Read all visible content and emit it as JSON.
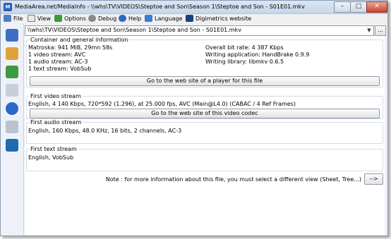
{
  "window": {
    "title": "MediaArea.net/MediaInfo - \\\\whs\\TV\\VIDEOS\\Steptoe and Son\\Season 1\\Steptoe and Son - S01E01.mkv"
  },
  "menu": {
    "file": "File",
    "view": "View",
    "options": "Options",
    "debug": "Debug",
    "help": "Help",
    "language": "Language",
    "website": "Digimetrics website"
  },
  "path": {
    "value": "\\\\whs\\TV\\VIDEOS\\Steptoe and Son\\Season 1\\Steptoe and Son - S01E01.mkv",
    "ellipsis": "..."
  },
  "general": {
    "title": "Container and general information",
    "left": [
      "Matroska: 941 MiB, 29mn 58s",
      "1 video stream: AVC",
      "1 audio stream: AC-3",
      "1 text stream: VobSub"
    ],
    "right": [
      "Overall bit rate: 4 387 Kbps",
      "Writing application: HandBrake 0.9.9",
      "Writing library: libmkv 0.6.5"
    ],
    "button": "Go to the web site of a player for this file"
  },
  "video": {
    "title": "First video stream",
    "info": "English, 4 140 Kbps, 720*592 (1.296), at 25.000 fps, AVC (Main@L4.0) (CABAC / 4 Ref Frames)",
    "button": "Go to the web site of this video codec"
  },
  "audio": {
    "title": "First audio stream",
    "info": "English, 160 Kbps, 48.0 KHz, 16 bits, 2 channels, AC-3"
  },
  "text": {
    "title": "First text stream",
    "info": "English, VobSub"
  },
  "note": {
    "text": "Note : for more information about this file, you must select a different view (Sheet, Tree...)",
    "button": "-->"
  },
  "colors": {
    "titlebar": "#c6d6ea",
    "close_button": "#c8432b",
    "window_bg": "#eef2f8"
  },
  "icons": {
    "app": "mediainfo-icon",
    "menu": [
      "file-icon",
      "view-icon",
      "options-icon",
      "debug-icon",
      "help-icon",
      "language-icon",
      "website-icon"
    ],
    "sidebar": [
      "open-file-icon",
      "open-folder-icon",
      "export-icon",
      "find-icon",
      "about-icon",
      "report-icon",
      "mediainfo-logo-icon"
    ]
  }
}
